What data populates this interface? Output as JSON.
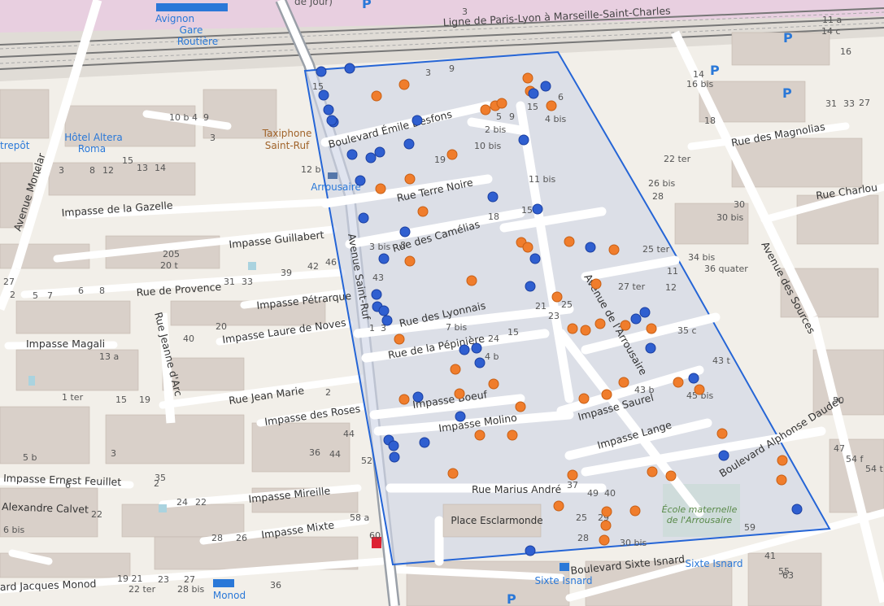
{
  "map": {
    "region_label": "Arrousaire",
    "streets": [
      {
        "id": "desfons",
        "label": "Boulevard Émile Desfons"
      },
      {
        "id": "terre-noire",
        "label": "Rue Terre Noire"
      },
      {
        "id": "camelias",
        "label": "Rue des Camélias"
      },
      {
        "id": "lyonnais",
        "label": "Rue des Lyonnais"
      },
      {
        "id": "pepiniere",
        "label": "Rue de la Pépinière"
      },
      {
        "id": "boeuf",
        "label": "Impasse Boeuf"
      },
      {
        "id": "molino",
        "label": "Impasse Molino"
      },
      {
        "id": "saurel",
        "label": "Impasse Saurel"
      },
      {
        "id": "lange",
        "label": "Impasse Lange"
      },
      {
        "id": "arrousaire",
        "label": "Avenue de l'Arrousaire"
      },
      {
        "id": "saint-ruf",
        "label": "Avenue Saint-Ruf"
      },
      {
        "id": "daudet",
        "label": "Boulevard Alphonse Daudet"
      },
      {
        "id": "marius",
        "label": "Rue Marius André"
      },
      {
        "id": "sixte",
        "label": "Boulevard Sixte Isnard"
      },
      {
        "id": "sources",
        "label": "Avenue des Sources"
      },
      {
        "id": "magnolias",
        "label": "Rue des Magnolias"
      },
      {
        "id": "charlou",
        "label": "Rue Charlou"
      },
      {
        "id": "gazelle",
        "label": "Impasse de la Gazelle"
      },
      {
        "id": "guillabert",
        "label": "Impasse Guillabert"
      },
      {
        "id": "provence",
        "label": "Rue de Provence"
      },
      {
        "id": "petrarque",
        "label": "Impasse Pétrarque"
      },
      {
        "id": "laure",
        "label": "Impasse Laure de Noves"
      },
      {
        "id": "magali",
        "label": "Impasse Magali"
      },
      {
        "id": "jean-marie",
        "label": "Rue Jean Marie"
      },
      {
        "id": "roses",
        "label": "Impasse des Roses"
      },
      {
        "id": "feuillet",
        "label": "Impasse Ernest Feuillet"
      },
      {
        "id": "calvet",
        "label": "Alexandre Calvet"
      },
      {
        "id": "mireille",
        "label": "Impasse Mireille"
      },
      {
        "id": "mixte",
        "label": "Impasse Mixte"
      },
      {
        "id": "monclar",
        "label": "Avenue Monclar"
      },
      {
        "id": "jeanne-arc",
        "label": "Rue Jeanne d'Arc"
      },
      {
        "id": "monod",
        "label": "ard Jacques Monod"
      },
      {
        "id": "railway",
        "label": "Ligne de Paris-Lyon à Marseille-Saint-Charles"
      }
    ],
    "places": [
      {
        "id": "gare",
        "label": "Avignon Gare Routière"
      },
      {
        "id": "altera",
        "label": "Hôtel Altera Roma"
      },
      {
        "id": "taxi",
        "label": "Taxiphone Saint-Ruf"
      },
      {
        "id": "esclarmonde",
        "label": "Place Esclarmonde"
      },
      {
        "id": "ecole",
        "label": "École maternelle de l'Arrousaire"
      },
      {
        "id": "bus-sixte-1",
        "label": "Sixte Isnard"
      },
      {
        "id": "bus-sixte-2",
        "label": "Sixte Isnard"
      },
      {
        "id": "bus-monod",
        "label": "Monod"
      },
      {
        "id": "entrepot",
        "label": "trepôt"
      },
      {
        "id": "jour",
        "label": "de Jour)"
      }
    ],
    "house_numbers": [
      "15",
      "9",
      "6",
      "3",
      "10 b",
      "4",
      "12 b",
      "10 bis",
      "11 bis",
      "15",
      "19",
      "7",
      "5",
      "3 bis",
      "43",
      "7 bis",
      "1",
      "3",
      "4 b",
      "25",
      "21",
      "24",
      "43 b",
      "45 bis",
      "43 t",
      "35 c",
      "27 ter",
      "25 ter",
      "11",
      "34 bis",
      "36 quater",
      "22 ter",
      "26 bis",
      "28",
      "30 bis",
      "30",
      "18",
      "16 bis",
      "14",
      "27",
      "31",
      "33",
      "11 a",
      "14 c",
      "16",
      "59",
      "37",
      "49",
      "40",
      "25",
      "29",
      "33",
      "28",
      "30 bis",
      "51",
      "55",
      "61",
      "63",
      "47",
      "54 f",
      "54 t",
      "50",
      "205",
      "20 t",
      "39",
      "42",
      "46",
      "31",
      "33",
      "26",
      "44",
      "52",
      "58 a",
      "60",
      "36",
      "25",
      "24",
      "22",
      "6",
      "2",
      "15",
      "19 21",
      "23",
      "27",
      "28 bis",
      "20",
      "40"
    ],
    "markers_blue": 40,
    "markers_orange": 48
  }
}
